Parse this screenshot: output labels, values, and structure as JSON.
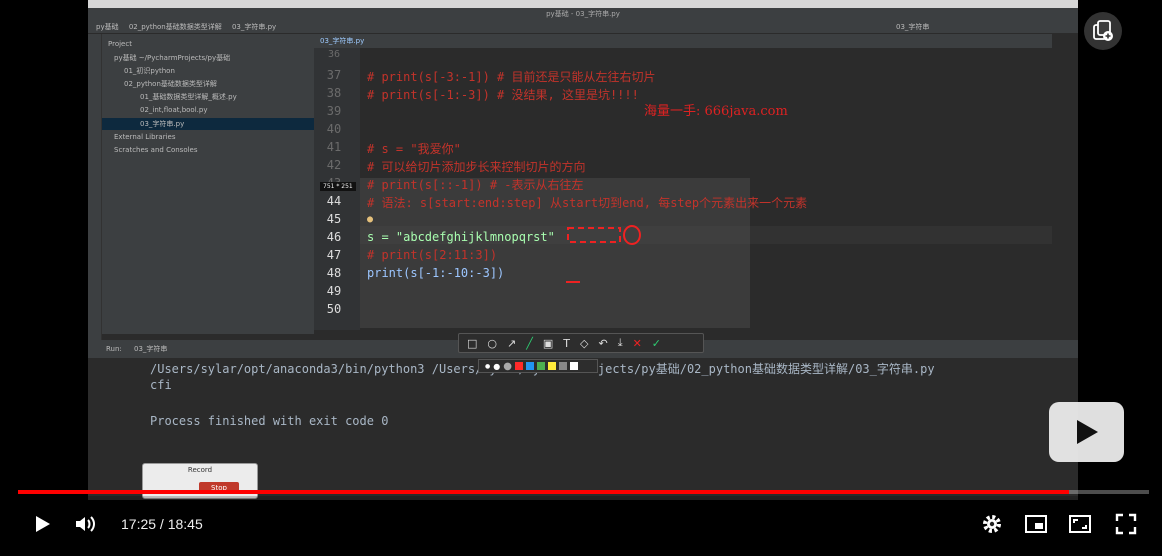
{
  "app": {
    "window_title": "py基础 - 03_字符串.py",
    "breadcrumbs": [
      "py基础",
      "02_python基础数据类型详解",
      "03_字符串.py"
    ],
    "editor_tab": "03_字符串.py",
    "run_config": "03_字符串"
  },
  "project_tree": {
    "header": "Project",
    "items": [
      {
        "label": "py基础 ~/PycharmProjects/py基础",
        "indent": 0
      },
      {
        "label": "01_初识python",
        "indent": 1
      },
      {
        "label": "02_python基础数据类型详解",
        "indent": 1
      },
      {
        "label": "01_基础数据类型详解_概述.py",
        "indent": 2
      },
      {
        "label": "02_int,float,bool.py",
        "indent": 2
      },
      {
        "label": "03_字符串.py",
        "indent": 2,
        "selected": true
      },
      {
        "label": "External Libraries",
        "indent": 0
      },
      {
        "label": "Scratches and Consoles",
        "indent": 0
      }
    ]
  },
  "editor": {
    "lines": [
      {
        "n": "37",
        "text": "# print(s[-3:-1])  # 目前还是只能从左往右切片",
        "kind": "comment"
      },
      {
        "n": "38",
        "text": "# print(s[-1:-3])  # 没结果, 这里是坑!!!!",
        "kind": "comment"
      },
      {
        "n": "39",
        "text": "",
        "kind": "code"
      },
      {
        "n": "40",
        "text": "",
        "kind": "code"
      },
      {
        "n": "41",
        "text": "# s = \"我爱你\"",
        "kind": "comment"
      },
      {
        "n": "42",
        "text": "# 可以给切片添加步长来控制切片的方向",
        "kind": "comment"
      },
      {
        "n": "43",
        "text": "# print(s[::-1])  # -表示从右往左",
        "kind": "comment"
      },
      {
        "n": "44",
        "text": "# 语法: s[start:end:step] 从start切到end, 每step个元素出来一个元素",
        "kind": "comment"
      },
      {
        "n": "45",
        "text": "",
        "kind": "code"
      },
      {
        "n": "46",
        "text": "s = \"abcdefghijklmnopqrst\"",
        "kind": "code"
      },
      {
        "n": "47",
        "text": "# print(s[2:11:3])",
        "kind": "comment"
      },
      {
        "n": "48",
        "text": "print(s[-1:-10:-3])",
        "kind": "code"
      },
      {
        "n": "49",
        "text": "",
        "kind": "code"
      },
      {
        "n": "50",
        "text": "",
        "kind": "code"
      }
    ],
    "top_line": "36",
    "selection_size": "751 * 251"
  },
  "watermark": "海量一手: 666java.com",
  "run": {
    "header": "Run:",
    "tab": "03_字符串",
    "command": "/Users/sylar/opt/anaconda3/bin/python3 /Users/sylar/PycharmProjects/py基础/02_python基础数据类型详解/03_字符串.py",
    "output": "cfi",
    "finish": "Process finished with exit code 0"
  },
  "record_window": {
    "title": "Record",
    "stop_label": "Stop"
  },
  "annotation_colors": [
    "#ff2a2a",
    "#2196f3",
    "#4caf50",
    "#ffeb3b",
    "#888888",
    "#ffffff"
  ],
  "player": {
    "current_time": "17:25",
    "duration": "18:45",
    "time_display": "17:25 / 18:45",
    "progress": 0.929
  }
}
